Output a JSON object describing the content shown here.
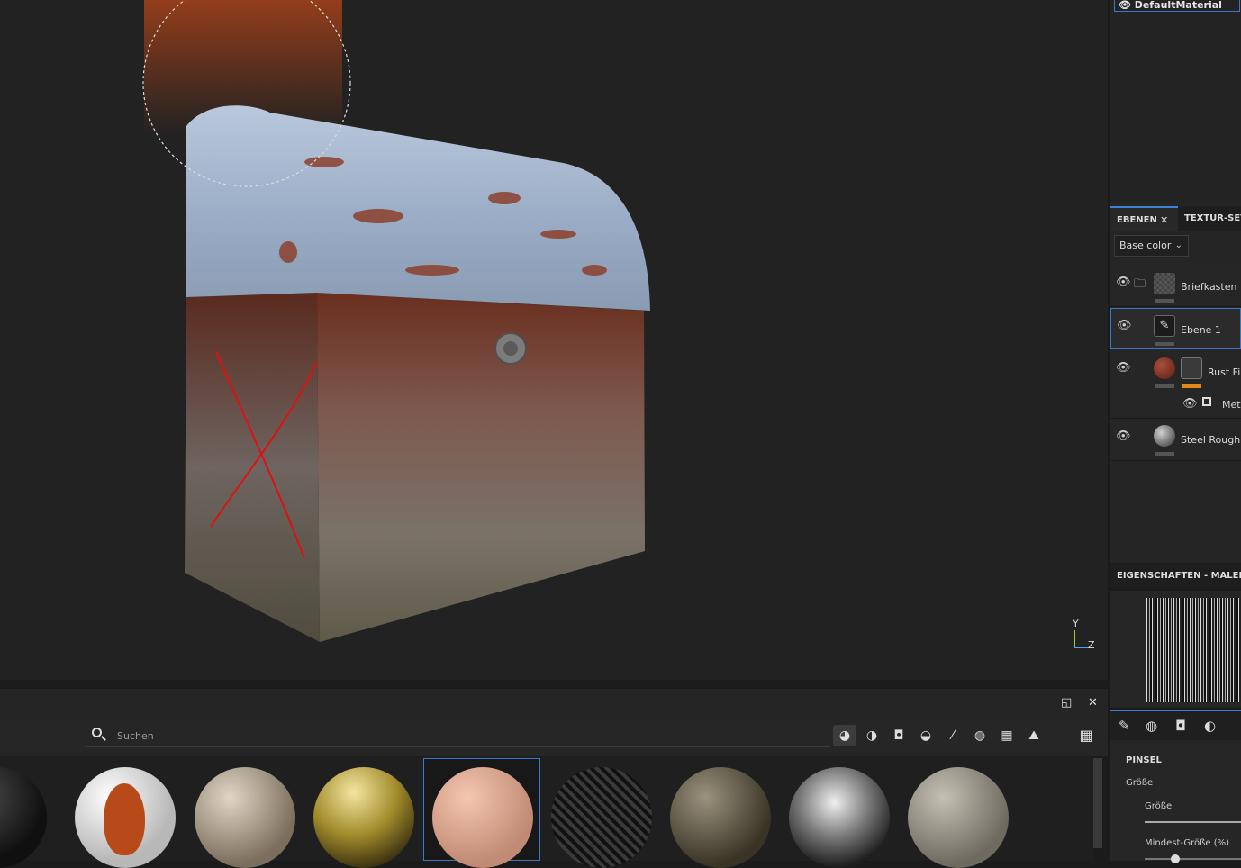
{
  "material_header": {
    "name": "DefaultMaterial"
  },
  "layers_panel": {
    "tabs": [
      {
        "label": "EBENEN",
        "active": true,
        "close": "✕"
      },
      {
        "label": "TEXTUR-SET",
        "active": false
      }
    ],
    "channel_select": {
      "value": "Base color"
    },
    "layers": [
      {
        "name": "Briefkasten",
        "type": "folder"
      },
      {
        "name": "Ebene 1",
        "type": "paint",
        "selected": true
      },
      {
        "name": "Rust Fine",
        "type": "fill-mask"
      },
      {
        "name": "Metal",
        "type": "sublayer"
      },
      {
        "name": "Steel Rough",
        "type": "fill"
      }
    ]
  },
  "properties": {
    "title": "EIGENSCHAFTEN - MALEN",
    "section": "PINSEL",
    "group_label": "Größe",
    "param_size": "Größe",
    "param_min_size": "Mindest-Größe (%)"
  },
  "viewport": {
    "axis_y": "Y",
    "axis_z": "Z"
  },
  "shelf": {
    "search_placeholder": "Suchen",
    "filters": [
      "smart-material-icon",
      "material-icon",
      "mask-icon",
      "filter-icon",
      "brush-icon",
      "alpha-icon",
      "procedural-icon",
      "environment-icon"
    ],
    "materials": [
      {
        "name": "black-plastic",
        "color": "#1c1c1c"
      },
      {
        "name": "leaf-sticker",
        "color": "#e8e8e8"
      },
      {
        "name": "beige-rubber",
        "color": "#b4a690"
      },
      {
        "name": "gold",
        "color": "#a08a2a"
      },
      {
        "name": "skin",
        "color": "#e0a890",
        "selected": true
      },
      {
        "name": "carbon-fiber",
        "color": "#2a2a2a"
      },
      {
        "name": "olive-metal",
        "color": "#5e5646"
      },
      {
        "name": "chrome",
        "color": "#9c9c9c"
      },
      {
        "name": "concrete",
        "color": "#8e8a80"
      }
    ]
  },
  "colors": {
    "accent": "#3c82d6",
    "opacity_orange": "#e08a1a",
    "red_cross": "#e01010"
  }
}
